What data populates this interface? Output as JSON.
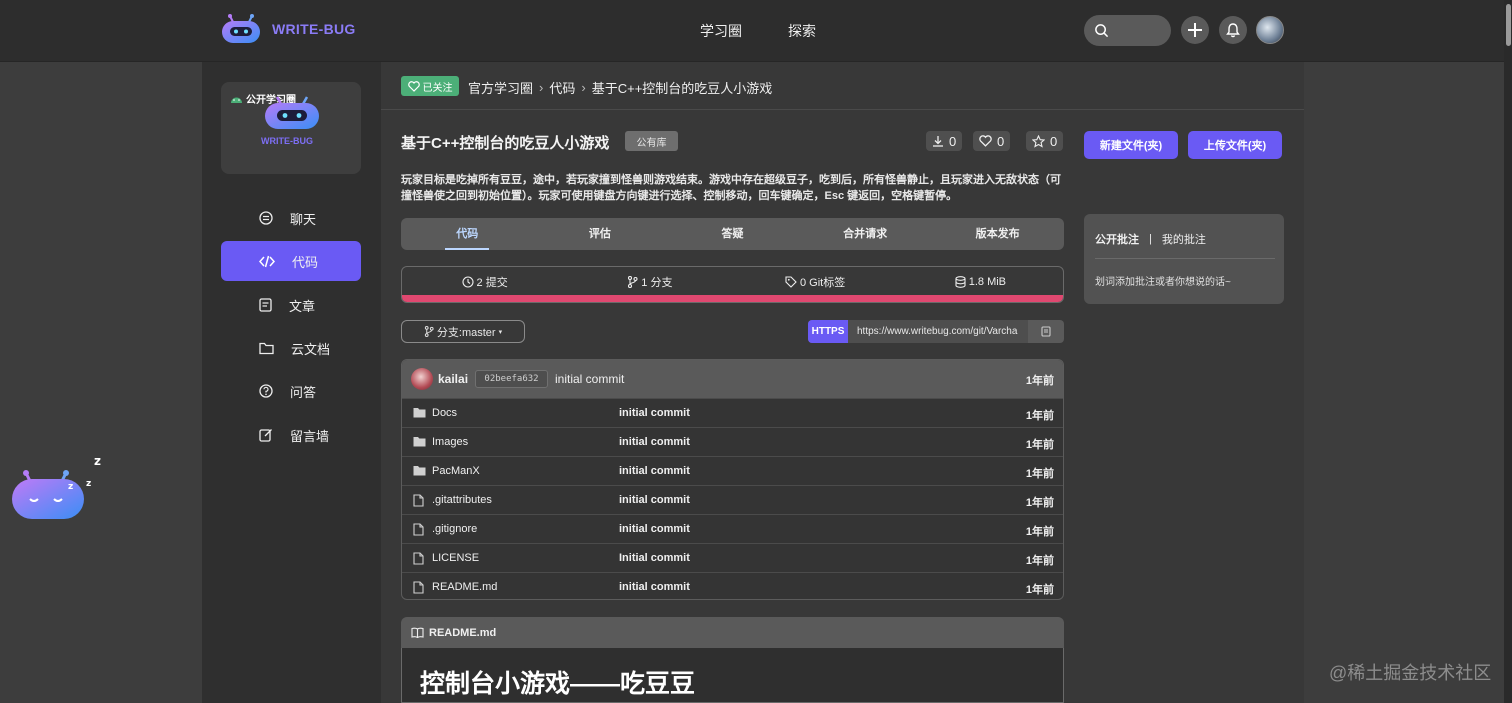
{
  "topbar": {
    "logo_text": "WRITE-BUG",
    "nav": [
      "学习圈",
      "探索"
    ]
  },
  "sidebar": {
    "group_tag": "公开学习圈",
    "group_logo_text": "WRITE-BUG",
    "items": [
      {
        "label": "聊天",
        "icon": "chat-icon"
      },
      {
        "label": "代码",
        "icon": "code-icon",
        "active": true
      },
      {
        "label": "文章",
        "icon": "article-icon"
      },
      {
        "label": "云文档",
        "icon": "folder-icon"
      },
      {
        "label": "问答",
        "icon": "question-icon"
      },
      {
        "label": "留言墙",
        "icon": "edit-icon"
      }
    ]
  },
  "breadcrumb": {
    "follow_badge": "已关注",
    "items": [
      "官方学习圈",
      "代码",
      "基于C++控制台的吃豆人小游戏"
    ]
  },
  "repo": {
    "title": "基于C++控制台的吃豆人小游戏",
    "visibility": "公有库",
    "downloads": "0",
    "likes": "0",
    "stars": "0",
    "description": "玩家目标是吃掉所有豆豆，途中，若玩家撞到怪兽则游戏结束。游戏中存在超级豆子，吃到后，所有怪兽静止，且玩家进入无敌状态（可撞怪兽使之回到初始位置）。玩家可使用键盘方向键进行选择、控制移动，回车键确定，Esc 键返回，空格键暂停。"
  },
  "tabs": [
    "代码",
    "评估",
    "答疑",
    "合并请求",
    "版本发布"
  ],
  "stats": {
    "commits": "2 提交",
    "branches": "1 分支",
    "tags": "0 Git标签",
    "size": "1.8 MiB"
  },
  "branch_selector": "分支:master",
  "clone": {
    "protocol": "HTTPS",
    "url": "https://www.writebug.com/git/Varcha"
  },
  "latest_commit": {
    "user": "kailai",
    "hash": "02beefa632",
    "message": "initial commit",
    "time": "1年前"
  },
  "files": [
    {
      "name": "Docs",
      "type": "folder",
      "message": "initial commit",
      "time": "1年前"
    },
    {
      "name": "Images",
      "type": "folder",
      "message": "initial commit",
      "time": "1年前"
    },
    {
      "name": "PacManX",
      "type": "folder",
      "message": "initial commit",
      "time": "1年前"
    },
    {
      "name": ".gitattributes",
      "type": "file",
      "message": "initial commit",
      "time": "1年前"
    },
    {
      "name": ".gitignore",
      "type": "file",
      "message": "initial commit",
      "time": "1年前"
    },
    {
      "name": "LICENSE",
      "type": "file",
      "message": "Initial commit",
      "time": "1年前"
    },
    {
      "name": "README.md",
      "type": "file",
      "message": "initial commit",
      "time": "1年前"
    }
  ],
  "readme": {
    "filename": "README.md",
    "heading": "控制台小游戏——吃豆豆"
  },
  "actions": {
    "new_file": "新建文件(夹)",
    "upload_file": "上传文件(夹)"
  },
  "notes": {
    "public_tab": "公开批注",
    "separator": "|",
    "mine_tab": "我的批注",
    "hint": "划词添加批注或者你想说的话~"
  },
  "watermark": "@稀土掘金技术社区",
  "colors": {
    "accent": "#6a5af4",
    "follow_green": "#4caf78",
    "progress_pink": "#e04870"
  }
}
